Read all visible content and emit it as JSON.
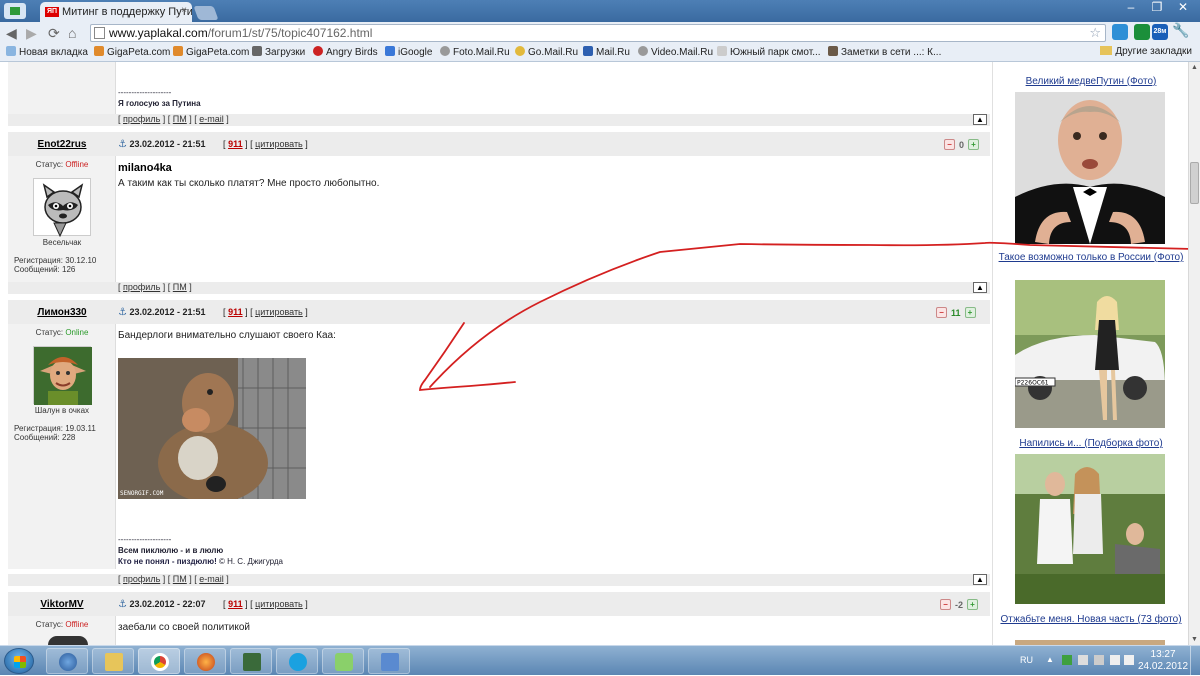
{
  "browser": {
    "tab_title": "Митинг в поддержку Пути",
    "tab_favicon": "ЯП",
    "close_glyph": "×",
    "window_buttons": [
      "–",
      "❐",
      "✕"
    ],
    "url_host": "www.yaplakal.com",
    "url_path": "/forum1/st/75/topic407162.html",
    "extension_badge": "28м",
    "bookmarks": [
      {
        "label": "Новая вкладка",
        "icon": "new-tab-icon"
      },
      {
        "label": "GigaPeta.com",
        "icon": "gigapeta-icon"
      },
      {
        "label": "GigaPeta.com",
        "icon": "gigapeta-icon"
      },
      {
        "label": "Загрузки",
        "icon": "download-icon"
      },
      {
        "label": "Angry Birds",
        "icon": "angry-birds-icon"
      },
      {
        "label": "iGoogle",
        "icon": "google-icon"
      },
      {
        "label": "Foto.Mail.Ru",
        "icon": "mailru-icon"
      },
      {
        "label": "Go.Mail.Ru",
        "icon": "search-icon"
      },
      {
        "label": "Mail.Ru",
        "icon": "mailru-icon"
      },
      {
        "label": "Video.Mail.Ru",
        "icon": "mailru-icon"
      },
      {
        "label": "Южный парк смот...",
        "icon": "page-icon"
      },
      {
        "label": "Заметки в сети ...: К...",
        "icon": "avatar-icon"
      }
    ],
    "other_bookmarks": "Другие закладки"
  },
  "forum": {
    "prev_post": {
      "sig_rule": "--------------------",
      "sig_line": "Я голосую за Путина",
      "footer": {
        "profile": "профиль",
        "pm": "ПМ",
        "email": "e-mail"
      }
    },
    "posts": [
      {
        "username": "Enot22rus",
        "status_label": "Статус:",
        "status": "Offline",
        "rank": "Весельчак",
        "reg_label": "Регистрация:",
        "reg_date": "30.12.10",
        "msgs_label": "Сообщений:",
        "msgs": "126",
        "date": "23.02.2012 - 21:51",
        "post_num": "911",
        "quote": "цитировать",
        "rating": "0",
        "subject": "milano4ka",
        "body": "А таким как ты сколько платят? Мне просто любопытно.",
        "footer": {
          "profile": "профиль",
          "pm": "ПМ"
        }
      },
      {
        "username": "Лимон330",
        "status_label": "Статус:",
        "status": "Online",
        "rank": "Шалун в очках",
        "reg_label": "Регистрация:",
        "reg_date": "19.03.11",
        "msgs_label": "Сообщений:",
        "msgs": "228",
        "date": "23.02.2012 - 21:51",
        "post_num": "911",
        "quote": "цитировать",
        "rating": "11",
        "body": "Бандерлоги внимательно слушают своего Каа:",
        "gif_caption": "SENORGIF.COM",
        "sig_rule": "--------------------",
        "sig_line1": "Всем пиклюлю - и в люлю",
        "sig_line2_bold": "Кто не понял - пиздюлю!",
        "sig_line2_tail": "© Н. С. Джигурда",
        "footer": {
          "profile": "профиль",
          "pm": "ПМ",
          "email": "e-mail"
        }
      },
      {
        "username": "ViktorMV",
        "status_label": "Статус:",
        "status": "Offline",
        "date": "23.02.2012 - 22:07",
        "post_num": "911",
        "quote": "цитировать",
        "rating": "-2",
        "body": "заебали со своей политикой"
      }
    ]
  },
  "sidebar": {
    "items": [
      {
        "title": "Великий медвеПутин (Фото)"
      },
      {
        "title": "Такое возможно только в России (Фото)"
      },
      {
        "title": "Напились и... (Подборка фото)"
      },
      {
        "title": "Отжабьте меня. Новая часть (73 фото)"
      }
    ],
    "car_plate": "Р226ОС61"
  },
  "taskbar": {
    "language": "RU",
    "time": "13:27",
    "date": "24.02.2012",
    "apps": [
      "thunderbird-icon",
      "explorer-icon",
      "chrome-icon",
      "firefox-icon",
      "network-monitor-icon",
      "skype-icon",
      "utility-icon",
      "remote-desktop-icon"
    ]
  },
  "colors": {
    "annotation_stroke": "#d42020",
    "offline": "#cc2222",
    "online": "#2a9a2a",
    "sidebar_link": "#1f3b8f"
  }
}
